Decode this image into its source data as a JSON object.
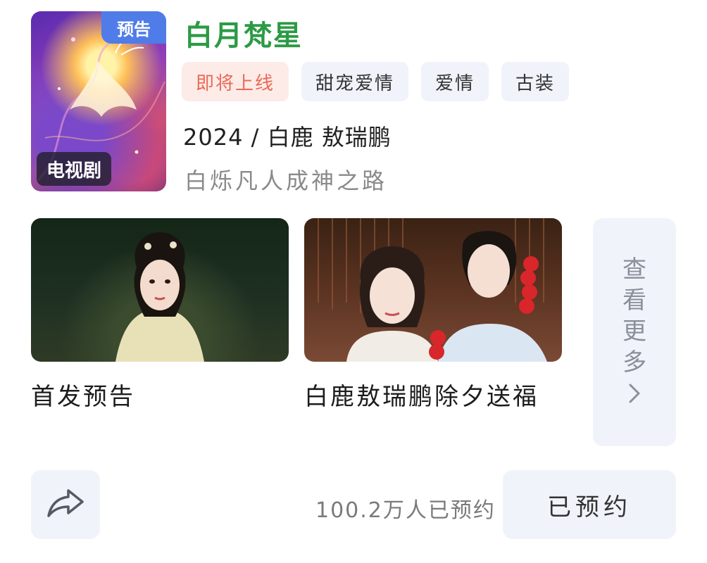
{
  "poster": {
    "badge_preview": "预告",
    "badge_type": "电视剧"
  },
  "show": {
    "title": "白月梵星",
    "tags": [
      "即将上线",
      "甜宠爱情",
      "爱情",
      "古装"
    ],
    "meta": "2024 / 白鹿  敖瑞鹏",
    "description": "白烁凡人成神之路"
  },
  "clips": [
    {
      "caption": "首发预告"
    },
    {
      "caption": "白鹿敖瑞鹏除夕送福"
    }
  ],
  "more": {
    "label_chars": [
      "查",
      "看",
      "更",
      "多"
    ],
    "chevron": "›"
  },
  "footer": {
    "reserved_count": "100.2万人已预约",
    "reserve_button": "已预约"
  },
  "colors": {
    "title": "#2c9a45",
    "status_tag": "#e96a55",
    "badge_blue": "#4f7ce8"
  }
}
